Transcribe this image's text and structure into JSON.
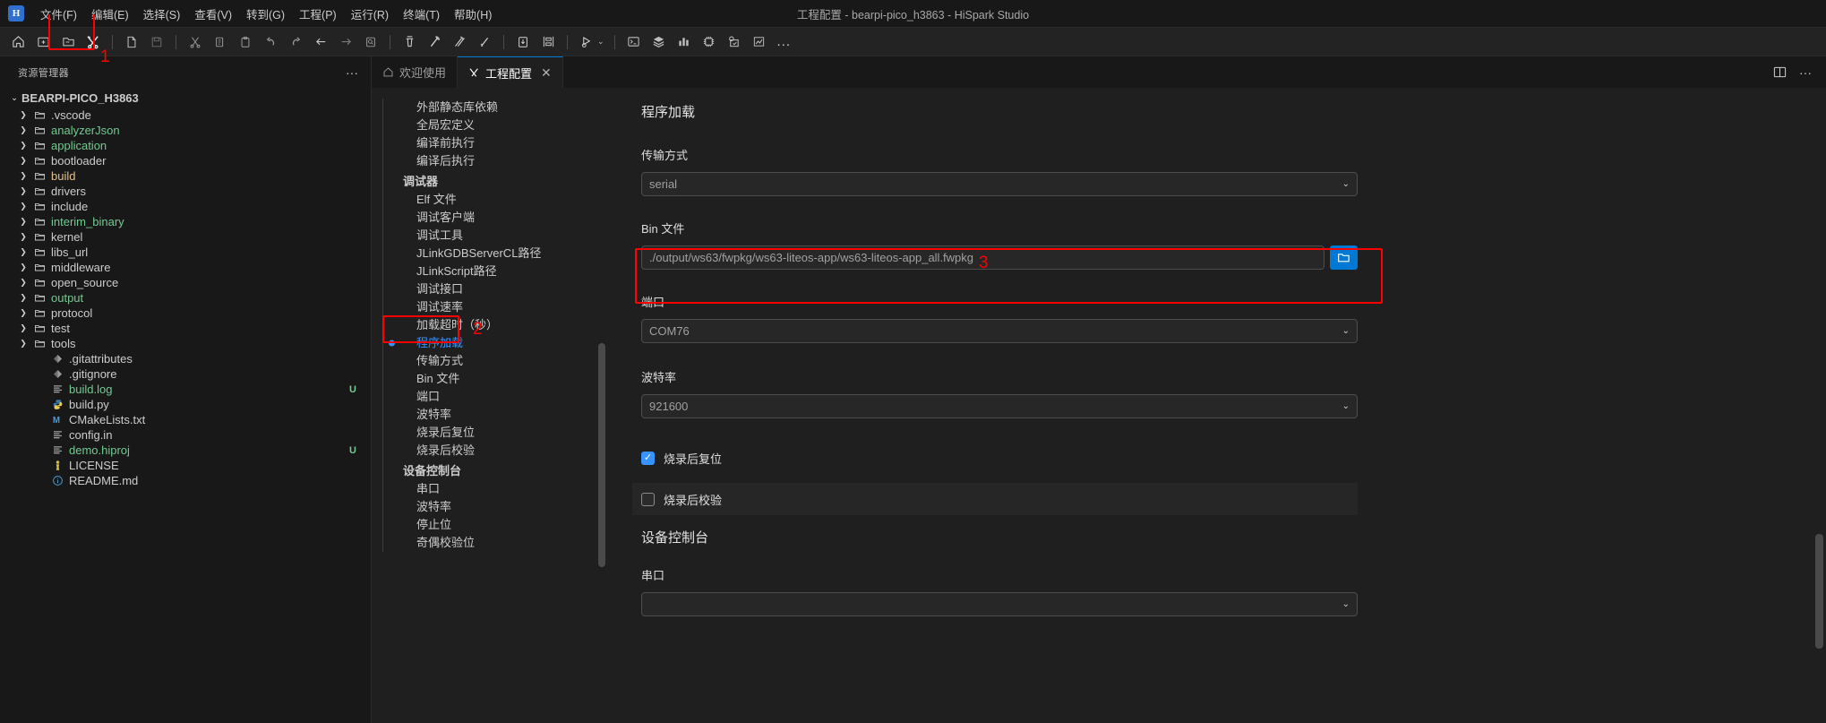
{
  "titlebar": {
    "logo_text": "H",
    "window_title": "工程配置 - bearpi-pico_h3863 - HiSpark Studio",
    "menus": [
      {
        "label": "文件(F)"
      },
      {
        "label": "编辑(E)"
      },
      {
        "label": "选择(S)"
      },
      {
        "label": "查看(V)"
      },
      {
        "label": "转到(G)"
      },
      {
        "label": "工程(P)"
      },
      {
        "label": "运行(R)"
      },
      {
        "label": "终端(T)"
      },
      {
        "label": "帮助(H)"
      }
    ]
  },
  "toolbar": {
    "icons": [
      {
        "name": "home-icon"
      },
      {
        "name": "new-folder-icon"
      },
      {
        "name": "open-folder-icon"
      },
      {
        "name": "tools-icon"
      },
      {
        "name": "new-file-icon"
      },
      {
        "name": "save-icon"
      },
      {
        "name": "cut-icon"
      },
      {
        "name": "copy-icon"
      },
      {
        "name": "paste-icon"
      },
      {
        "name": "undo-icon"
      },
      {
        "name": "redo-icon"
      },
      {
        "name": "back-arrow-icon"
      },
      {
        "name": "forward-arrow-icon"
      },
      {
        "name": "find-icon"
      },
      {
        "name": "clean-icon"
      },
      {
        "name": "build-icon"
      },
      {
        "name": "rebuild-icon"
      },
      {
        "name": "build-all-icon"
      },
      {
        "name": "download-icon"
      },
      {
        "name": "serial-config-icon"
      },
      {
        "name": "debug-run-icon"
      },
      {
        "name": "terminal-icon"
      },
      {
        "name": "layers-icon"
      },
      {
        "name": "chart-bar-icon"
      },
      {
        "name": "chip-icon"
      },
      {
        "name": "device-config-icon"
      },
      {
        "name": "trend-icon"
      }
    ],
    "more_label": "..."
  },
  "annotations": [
    {
      "id": "1",
      "label": "1",
      "target": "tools-icon"
    },
    {
      "id": "2",
      "label": "2",
      "target": "nav-item-program-load"
    },
    {
      "id": "3",
      "label": "3",
      "target": "port-field"
    }
  ],
  "sidebar": {
    "header_title": "资源管理器",
    "more_label": "···",
    "root_label": "BEARPI-PICO_H3863",
    "items": [
      {
        "label": ".vscode",
        "type": "folder",
        "color": "#cccccc",
        "badge": ""
      },
      {
        "label": "analyzerJson",
        "type": "folder",
        "color": "#73c991",
        "badge": ""
      },
      {
        "label": "application",
        "type": "folder",
        "color": "#73c991",
        "badge": ""
      },
      {
        "label": "bootloader",
        "type": "folder",
        "color": "#cccccc",
        "badge": ""
      },
      {
        "label": "build",
        "type": "folder",
        "color": "#e2c08d",
        "badge": ""
      },
      {
        "label": "drivers",
        "type": "folder",
        "color": "#cccccc",
        "badge": ""
      },
      {
        "label": "include",
        "type": "folder",
        "color": "#cccccc",
        "badge": ""
      },
      {
        "label": "interim_binary",
        "type": "folder",
        "color": "#73c991",
        "badge": ""
      },
      {
        "label": "kernel",
        "type": "folder",
        "color": "#cccccc",
        "badge": ""
      },
      {
        "label": "libs_url",
        "type": "folder",
        "color": "#cccccc",
        "badge": ""
      },
      {
        "label": "middleware",
        "type": "folder",
        "color": "#cccccc",
        "badge": ""
      },
      {
        "label": "open_source",
        "type": "folder",
        "color": "#cccccc",
        "badge": ""
      },
      {
        "label": "output",
        "type": "folder",
        "color": "#73c991",
        "badge": ""
      },
      {
        "label": "protocol",
        "type": "folder",
        "color": "#cccccc",
        "badge": ""
      },
      {
        "label": "test",
        "type": "folder",
        "color": "#cccccc",
        "badge": ""
      },
      {
        "label": "tools",
        "type": "folder",
        "color": "#cccccc",
        "badge": ""
      },
      {
        "label": ".gitattributes",
        "type": "git",
        "color": "#cccccc",
        "badge": ""
      },
      {
        "label": ".gitignore",
        "type": "git",
        "color": "#cccccc",
        "badge": ""
      },
      {
        "label": "build.log",
        "type": "text",
        "color": "#73c991",
        "badge": "U"
      },
      {
        "label": "build.py",
        "type": "python",
        "color": "#cccccc",
        "badge": ""
      },
      {
        "label": "CMakeLists.txt",
        "type": "cmake",
        "color": "#cccccc",
        "badge": ""
      },
      {
        "label": "config.in",
        "type": "text",
        "color": "#cccccc",
        "badge": ""
      },
      {
        "label": "demo.hiproj",
        "type": "text",
        "color": "#73c991",
        "badge": "U"
      },
      {
        "label": "LICENSE",
        "type": "license",
        "color": "#cccccc",
        "badge": ""
      },
      {
        "label": "README.md",
        "type": "info",
        "color": "#cccccc",
        "badge": ""
      }
    ]
  },
  "tabs": [
    {
      "label": "欢迎使用",
      "icon": "welcome-icon",
      "active": false,
      "closable": false
    },
    {
      "label": "工程配置",
      "icon": "tools-icon",
      "active": true,
      "closable": true
    }
  ],
  "tab_actions": {
    "split_editor_label": "split-editor-icon",
    "more_actions_label": "···"
  },
  "confnav": {
    "items": [
      {
        "label": "外部静态库依赖",
        "type": "item",
        "active": false
      },
      {
        "label": "全局宏定义",
        "type": "item",
        "active": false
      },
      {
        "label": "编译前执行",
        "type": "item",
        "active": false
      },
      {
        "label": "编译后执行",
        "type": "item",
        "active": false
      },
      {
        "label": "调试器",
        "type": "group",
        "active": false
      },
      {
        "label": "Elf 文件",
        "type": "item",
        "active": false
      },
      {
        "label": "调试客户端",
        "type": "item",
        "active": false
      },
      {
        "label": "调试工具",
        "type": "item",
        "active": false
      },
      {
        "label": "JLinkGDBServerCL路径",
        "type": "item",
        "active": false
      },
      {
        "label": "JLinkScript路径",
        "type": "item",
        "active": false
      },
      {
        "label": "调试接口",
        "type": "item",
        "active": false
      },
      {
        "label": "调试速率",
        "type": "item",
        "active": false
      },
      {
        "label": "加载超时（秒）",
        "type": "item",
        "active": false
      },
      {
        "label": "程序加载",
        "type": "item",
        "active": true
      },
      {
        "label": "传输方式",
        "type": "item",
        "active": false
      },
      {
        "label": "Bin 文件",
        "type": "item",
        "active": false
      },
      {
        "label": "端口",
        "type": "item",
        "active": false
      },
      {
        "label": "波特率",
        "type": "item",
        "active": false
      },
      {
        "label": "烧录后复位",
        "type": "item",
        "active": false
      },
      {
        "label": "烧录后校验",
        "type": "item",
        "active": false
      },
      {
        "label": "设备控制台",
        "type": "group",
        "active": false
      },
      {
        "label": "串口",
        "type": "item",
        "active": false
      },
      {
        "label": "波特率",
        "type": "item",
        "active": false
      },
      {
        "label": "停止位",
        "type": "item",
        "active": false
      },
      {
        "label": "奇偶校验位",
        "type": "item",
        "active": false
      }
    ]
  },
  "settings": {
    "title": "程序加载",
    "transfer_mode": {
      "label": "传输方式",
      "value": "serial"
    },
    "bin_file": {
      "label": "Bin 文件",
      "value": "./output/ws63/fwpkg/ws63-liteos-app/ws63-liteos-app_all.fwpkg",
      "browse_icon": "folder-open-icon"
    },
    "port": {
      "label": "端口",
      "value": "COM76"
    },
    "baud_rate": {
      "label": "波特率",
      "value": "921600"
    },
    "reset_after_flash": {
      "label": "烧录后复位",
      "checked": true,
      "check_glyph": "✓"
    },
    "verify_after_flash": {
      "label": "烧录后校验",
      "checked": false,
      "check_glyph": ""
    },
    "device_console": {
      "title": "设备控制台",
      "serial_port": {
        "label": "串口",
        "value": ""
      }
    },
    "accent_color": "#3794ff",
    "annotation_color": "#ff0000"
  }
}
